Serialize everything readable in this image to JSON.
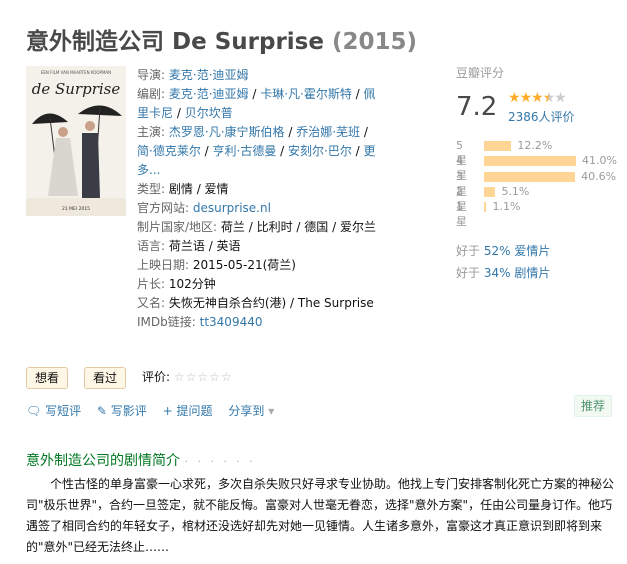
{
  "title": "意外制造公司 De Surprise",
  "year": "(2015)",
  "poster": {
    "caption": "de Surprise",
    "top_text": "EEN FILM VAN MAARTEN KOOPMAN",
    "date": "21 MEI 2015"
  },
  "info": {
    "director_label": "导演:",
    "director": "麦克·范·迪亚姆",
    "writer_label": "编剧:",
    "writers": [
      "麦克·范·迪亚姆",
      "卡琳·凡·霍尔斯特",
      "佩里卡尼",
      "贝尔坎普"
    ],
    "cast_label": "主演:",
    "cast": [
      "杰罗恩·凡·康宁斯伯格",
      "乔治娜·芜班",
      "简·德克莱尔",
      "亨利·古德曼",
      "安刻尔·巴尔"
    ],
    "cast_more": "更多...",
    "genre_label": "类型:",
    "genre": "剧情 / 爱情",
    "site_label": "官方网站:",
    "site": "desurprise.nl",
    "country_label": "制片国家/地区:",
    "country": "荷兰 / 比利时 / 德国 / 爱尔兰",
    "lang_label": "语言:",
    "lang": "荷兰语 / 英语",
    "release_label": "上映日期:",
    "release": "2015-05-21(荷兰)",
    "runtime_label": "片长:",
    "runtime": "102分钟",
    "aka_label": "又名:",
    "aka": "失恢无神自杀合约(港) / The Surprise",
    "imdb_label": "IMDb链接:",
    "imdb": "tt3409440"
  },
  "rating": {
    "label": "豆瓣评分",
    "score": "7.2",
    "stars_value": 3.5,
    "votes": "2386人评价",
    "dist": [
      {
        "star": "5星",
        "pct": "12.2%",
        "value": 12.2
      },
      {
        "star": "4星",
        "pct": "41.0%",
        "value": 41.0
      },
      {
        "star": "3星",
        "pct": "40.6%",
        "value": 40.6
      },
      {
        "star": "2星",
        "pct": "5.1%",
        "value": 5.1
      },
      {
        "star": "1星",
        "pct": "1.1%",
        "value": 1.1
      }
    ],
    "better1_pre": "好于 ",
    "better1_pct": "52%",
    "better1_cat": "爱情片",
    "better2_pre": "好于 ",
    "better2_pct": "34%",
    "better2_cat": "剧情片"
  },
  "buttons": {
    "want": "想看",
    "seen": "看过",
    "rate_label": "评价:",
    "rate_stars": "☆☆☆☆☆"
  },
  "actions": {
    "short_review": "写短评",
    "review": "写影评",
    "ask": "提问题",
    "share": "分享到",
    "recommend": "推荐"
  },
  "synopsis": {
    "heading": "意外制造公司的剧情简介",
    "dots": "· · · · · ·",
    "text": "个性古怪的单身富豪一心求死，多次自杀失败只好寻求专业协助。他找上专门安排客制化死亡方案的神秘公司\"极乐世界\"，合约一旦签定，就不能反悔。富豪对人世毫无眷恋，选择\"意外方案\"，任由公司量身订作。他巧遇签了相同合约的年轻女子，棺材还没选好却先对她一见锺情。人生诸多意外，富豪这才真正意识到即将到来的\"意外\"已经无法终止……"
  }
}
